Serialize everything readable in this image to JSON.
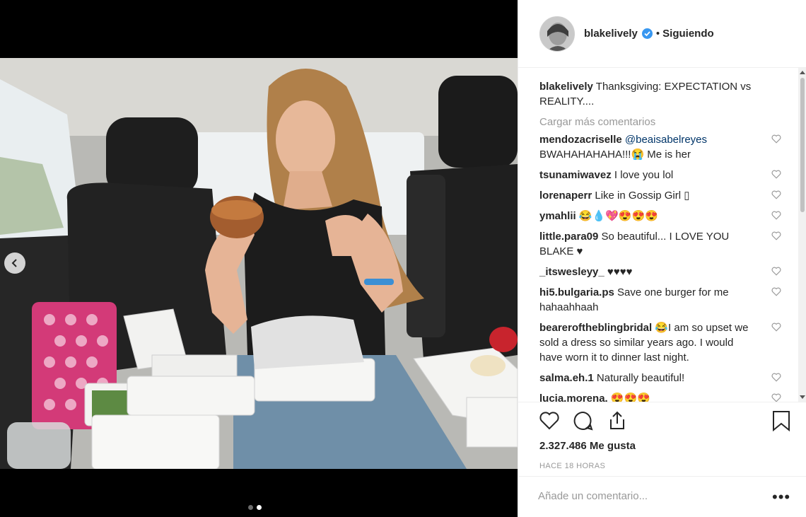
{
  "post": {
    "username": "blakelively",
    "dot": "•",
    "follow_status": "Siguiendo",
    "caption_user": "blakelively",
    "caption_text": "Thanksgiving: EXPECTATION vs REALITY....",
    "load_more": "Cargar más comentarios",
    "likes": "2.327.486 Me gusta",
    "time": "HACE 18 HORAS",
    "add_comment_placeholder": "Añade un comentario...",
    "more_options": "•••"
  },
  "comments": [
    {
      "user": "mendozacriselle",
      "mention": "@beaisabelreyes",
      "text": "BWAHAHAHAHA!!!😭 Me is her"
    },
    {
      "user": "tsunamiwavez",
      "mention": "",
      "text": "I love you lol"
    },
    {
      "user": "lorenaperr",
      "mention": "",
      "text": "Like in Gossip Girl ▯"
    },
    {
      "user": "ymahlii",
      "mention": "",
      "text": "😂💧💖😍😍😍"
    },
    {
      "user": "little.para09",
      "mention": "",
      "text": "So beautiful... I LOVE YOU BLAKE ♥"
    },
    {
      "user": "_itswesleyy_",
      "mention": "",
      "text": "♥♥♥♥"
    },
    {
      "user": "hi5.bulgaria.ps",
      "mention": "",
      "text": "Save one burger for me hahaahhaah"
    },
    {
      "user": "beareroftheblingbridal",
      "mention": "",
      "text": "😂I am so upset we sold a dress so similar years ago. I would have worn it to dinner last night."
    },
    {
      "user": "salma.eh.1",
      "mention": "",
      "text": "Naturally beautiful!"
    },
    {
      "user": "lucia.morena.",
      "mention": "",
      "text": "😍😍😍"
    }
  ],
  "colors": {
    "verified": "#3897f0",
    "mention": "#003569",
    "muted": "#999999"
  },
  "icons": [
    "verified-badge-icon",
    "heart-icon",
    "comment-icon",
    "share-icon",
    "bookmark-icon",
    "chevron-left-icon"
  ]
}
